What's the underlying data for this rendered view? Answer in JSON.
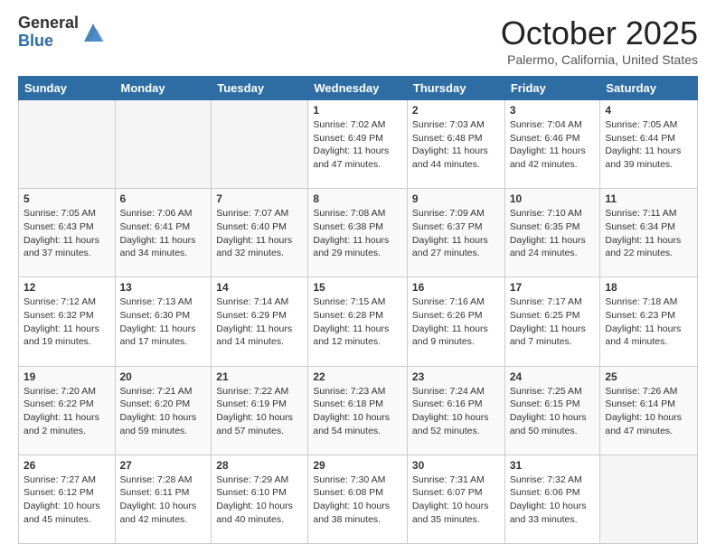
{
  "logo": {
    "general": "General",
    "blue": "Blue"
  },
  "header": {
    "month": "October 2025",
    "location": "Palermo, California, United States"
  },
  "weekdays": [
    "Sunday",
    "Monday",
    "Tuesday",
    "Wednesday",
    "Thursday",
    "Friday",
    "Saturday"
  ],
  "weeks": [
    [
      {
        "day": "",
        "info": ""
      },
      {
        "day": "",
        "info": ""
      },
      {
        "day": "",
        "info": ""
      },
      {
        "day": "1",
        "info": "Sunrise: 7:02 AM\nSunset: 6:49 PM\nDaylight: 11 hours and 47 minutes."
      },
      {
        "day": "2",
        "info": "Sunrise: 7:03 AM\nSunset: 6:48 PM\nDaylight: 11 hours and 44 minutes."
      },
      {
        "day": "3",
        "info": "Sunrise: 7:04 AM\nSunset: 6:46 PM\nDaylight: 11 hours and 42 minutes."
      },
      {
        "day": "4",
        "info": "Sunrise: 7:05 AM\nSunset: 6:44 PM\nDaylight: 11 hours and 39 minutes."
      }
    ],
    [
      {
        "day": "5",
        "info": "Sunrise: 7:05 AM\nSunset: 6:43 PM\nDaylight: 11 hours and 37 minutes."
      },
      {
        "day": "6",
        "info": "Sunrise: 7:06 AM\nSunset: 6:41 PM\nDaylight: 11 hours and 34 minutes."
      },
      {
        "day": "7",
        "info": "Sunrise: 7:07 AM\nSunset: 6:40 PM\nDaylight: 11 hours and 32 minutes."
      },
      {
        "day": "8",
        "info": "Sunrise: 7:08 AM\nSunset: 6:38 PM\nDaylight: 11 hours and 29 minutes."
      },
      {
        "day": "9",
        "info": "Sunrise: 7:09 AM\nSunset: 6:37 PM\nDaylight: 11 hours and 27 minutes."
      },
      {
        "day": "10",
        "info": "Sunrise: 7:10 AM\nSunset: 6:35 PM\nDaylight: 11 hours and 24 minutes."
      },
      {
        "day": "11",
        "info": "Sunrise: 7:11 AM\nSunset: 6:34 PM\nDaylight: 11 hours and 22 minutes."
      }
    ],
    [
      {
        "day": "12",
        "info": "Sunrise: 7:12 AM\nSunset: 6:32 PM\nDaylight: 11 hours and 19 minutes."
      },
      {
        "day": "13",
        "info": "Sunrise: 7:13 AM\nSunset: 6:30 PM\nDaylight: 11 hours and 17 minutes."
      },
      {
        "day": "14",
        "info": "Sunrise: 7:14 AM\nSunset: 6:29 PM\nDaylight: 11 hours and 14 minutes."
      },
      {
        "day": "15",
        "info": "Sunrise: 7:15 AM\nSunset: 6:28 PM\nDaylight: 11 hours and 12 minutes."
      },
      {
        "day": "16",
        "info": "Sunrise: 7:16 AM\nSunset: 6:26 PM\nDaylight: 11 hours and 9 minutes."
      },
      {
        "day": "17",
        "info": "Sunrise: 7:17 AM\nSunset: 6:25 PM\nDaylight: 11 hours and 7 minutes."
      },
      {
        "day": "18",
        "info": "Sunrise: 7:18 AM\nSunset: 6:23 PM\nDaylight: 11 hours and 4 minutes."
      }
    ],
    [
      {
        "day": "19",
        "info": "Sunrise: 7:20 AM\nSunset: 6:22 PM\nDaylight: 11 hours and 2 minutes."
      },
      {
        "day": "20",
        "info": "Sunrise: 7:21 AM\nSunset: 6:20 PM\nDaylight: 10 hours and 59 minutes."
      },
      {
        "day": "21",
        "info": "Sunrise: 7:22 AM\nSunset: 6:19 PM\nDaylight: 10 hours and 57 minutes."
      },
      {
        "day": "22",
        "info": "Sunrise: 7:23 AM\nSunset: 6:18 PM\nDaylight: 10 hours and 54 minutes."
      },
      {
        "day": "23",
        "info": "Sunrise: 7:24 AM\nSunset: 6:16 PM\nDaylight: 10 hours and 52 minutes."
      },
      {
        "day": "24",
        "info": "Sunrise: 7:25 AM\nSunset: 6:15 PM\nDaylight: 10 hours and 50 minutes."
      },
      {
        "day": "25",
        "info": "Sunrise: 7:26 AM\nSunset: 6:14 PM\nDaylight: 10 hours and 47 minutes."
      }
    ],
    [
      {
        "day": "26",
        "info": "Sunrise: 7:27 AM\nSunset: 6:12 PM\nDaylight: 10 hours and 45 minutes."
      },
      {
        "day": "27",
        "info": "Sunrise: 7:28 AM\nSunset: 6:11 PM\nDaylight: 10 hours and 42 minutes."
      },
      {
        "day": "28",
        "info": "Sunrise: 7:29 AM\nSunset: 6:10 PM\nDaylight: 10 hours and 40 minutes."
      },
      {
        "day": "29",
        "info": "Sunrise: 7:30 AM\nSunset: 6:08 PM\nDaylight: 10 hours and 38 minutes."
      },
      {
        "day": "30",
        "info": "Sunrise: 7:31 AM\nSunset: 6:07 PM\nDaylight: 10 hours and 35 minutes."
      },
      {
        "day": "31",
        "info": "Sunrise: 7:32 AM\nSunset: 6:06 PM\nDaylight: 10 hours and 33 minutes."
      },
      {
        "day": "",
        "info": ""
      }
    ]
  ]
}
